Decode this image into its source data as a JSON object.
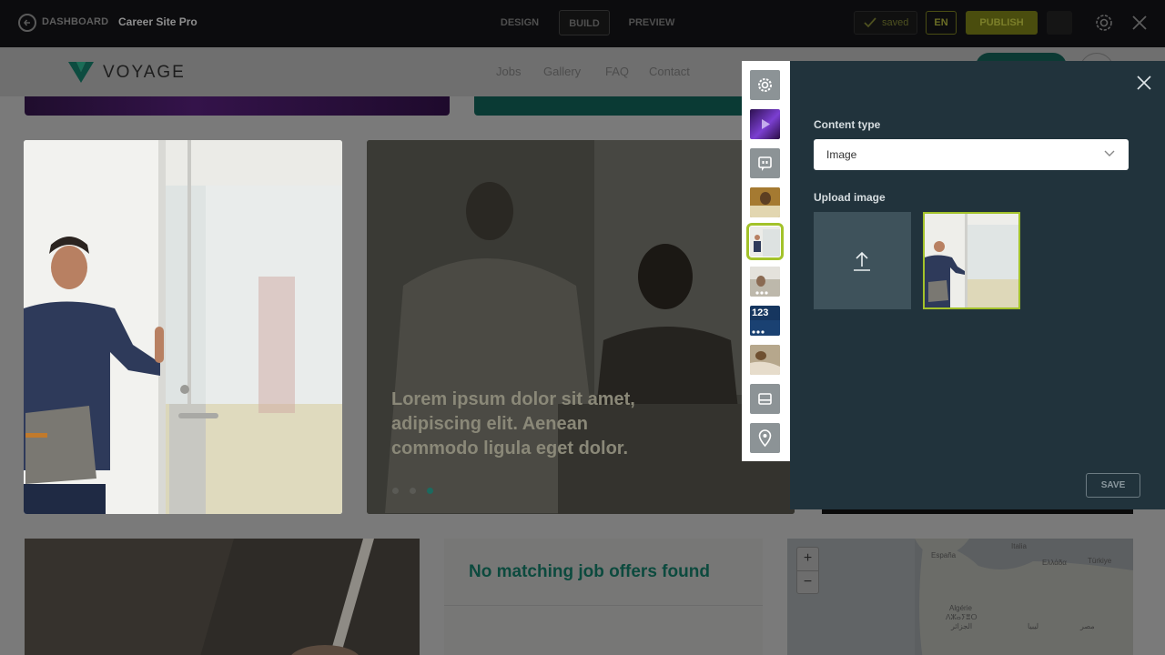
{
  "topbar": {
    "dashboard_label": "DASHBOARD",
    "site_name": "Career Site Pro",
    "modes": [
      "DESIGN",
      "BUILD",
      "PREVIEW"
    ],
    "active_mode": "BUILD",
    "status": "saved",
    "language": "EN",
    "publish_label": "PUBLISH"
  },
  "site": {
    "brand": "VOYAGE",
    "nav": [
      "Jobs",
      "Gallery",
      "FAQ",
      "Contact"
    ],
    "slider_caption": "Lorem ipsum dolor sit amet, adipiscing elit. Aenean commodo ligula eget dolor.",
    "jobs_message": "No matching job offers found",
    "map": {
      "zoom_in": "+",
      "zoom_out": "−",
      "labels": [
        "España",
        "Italia",
        "Ελλάδα",
        "Türkiye",
        "Algérie",
        "ⴷⵣⴰⵢⴻⵔ",
        "الجزائر",
        "ليبيا",
        "مصر"
      ]
    }
  },
  "picker": {
    "items": [
      "settings-icon",
      "video-thumbnail",
      "quote-icon",
      "image-thumbnail",
      "image-thumbnail",
      "slider-thumbnail",
      "counter-thumbnail",
      "image-thumbnail",
      "list-icon",
      "map-pin-icon"
    ],
    "counter_text": "123",
    "selected_index": 4
  },
  "panel": {
    "content_type_label": "Content type",
    "content_type_value": "Image",
    "upload_label": "Upload image",
    "save_label": "SAVE"
  },
  "colors": {
    "accent": "#a3c22a",
    "panel_bg": "#21333c",
    "brand_teal": "#0c4a3e"
  }
}
